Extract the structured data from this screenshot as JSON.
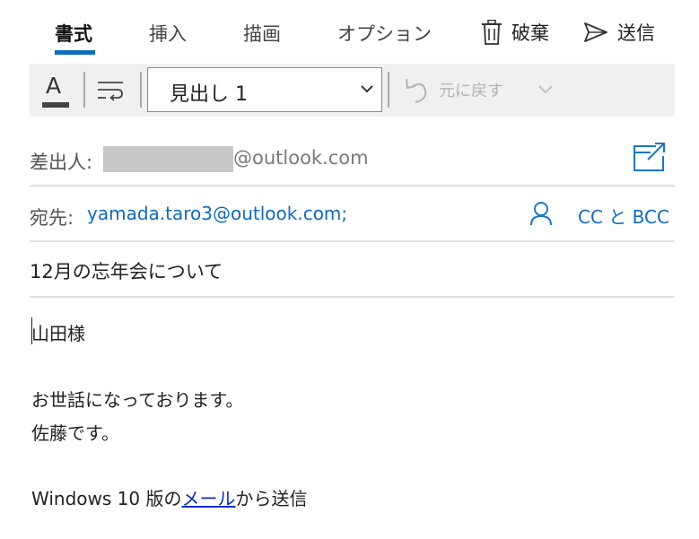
{
  "tabs": [
    {
      "label": "書式",
      "active": true
    },
    {
      "label": "挿入"
    },
    {
      "label": "描画"
    },
    {
      "label": "オプション"
    }
  ],
  "actions": {
    "discard_label": "破棄",
    "send_label": "送信"
  },
  "toolbar": {
    "font_color_glyph": "A",
    "style_value": "見出し 1",
    "undo_label": "元に戻す"
  },
  "from": {
    "label": "差出人:",
    "email_suffix": "@outlook.com"
  },
  "to": {
    "label": "宛先:",
    "recipient": "yamada.taro3@outlook.com;",
    "cc_bcc_label": "CC と BCC"
  },
  "subject": "12月の忘年会について",
  "body": {
    "greeting": "山田様",
    "line1": "お世話になっております。",
    "line2": "佐藤です。",
    "signature_prefix": "Windows 10 版の",
    "signature_link": "メール",
    "signature_suffix": "から送信"
  },
  "colors": {
    "accent": "#0f6cbd",
    "toolbar_bg": "#f0f0f0",
    "disabled": "#b4b4b4"
  },
  "icons": [
    "trash-icon",
    "send-icon",
    "font-color-icon",
    "text-format-icon",
    "chevron-down-icon",
    "undo-icon",
    "popout-icon",
    "person-icon"
  ]
}
